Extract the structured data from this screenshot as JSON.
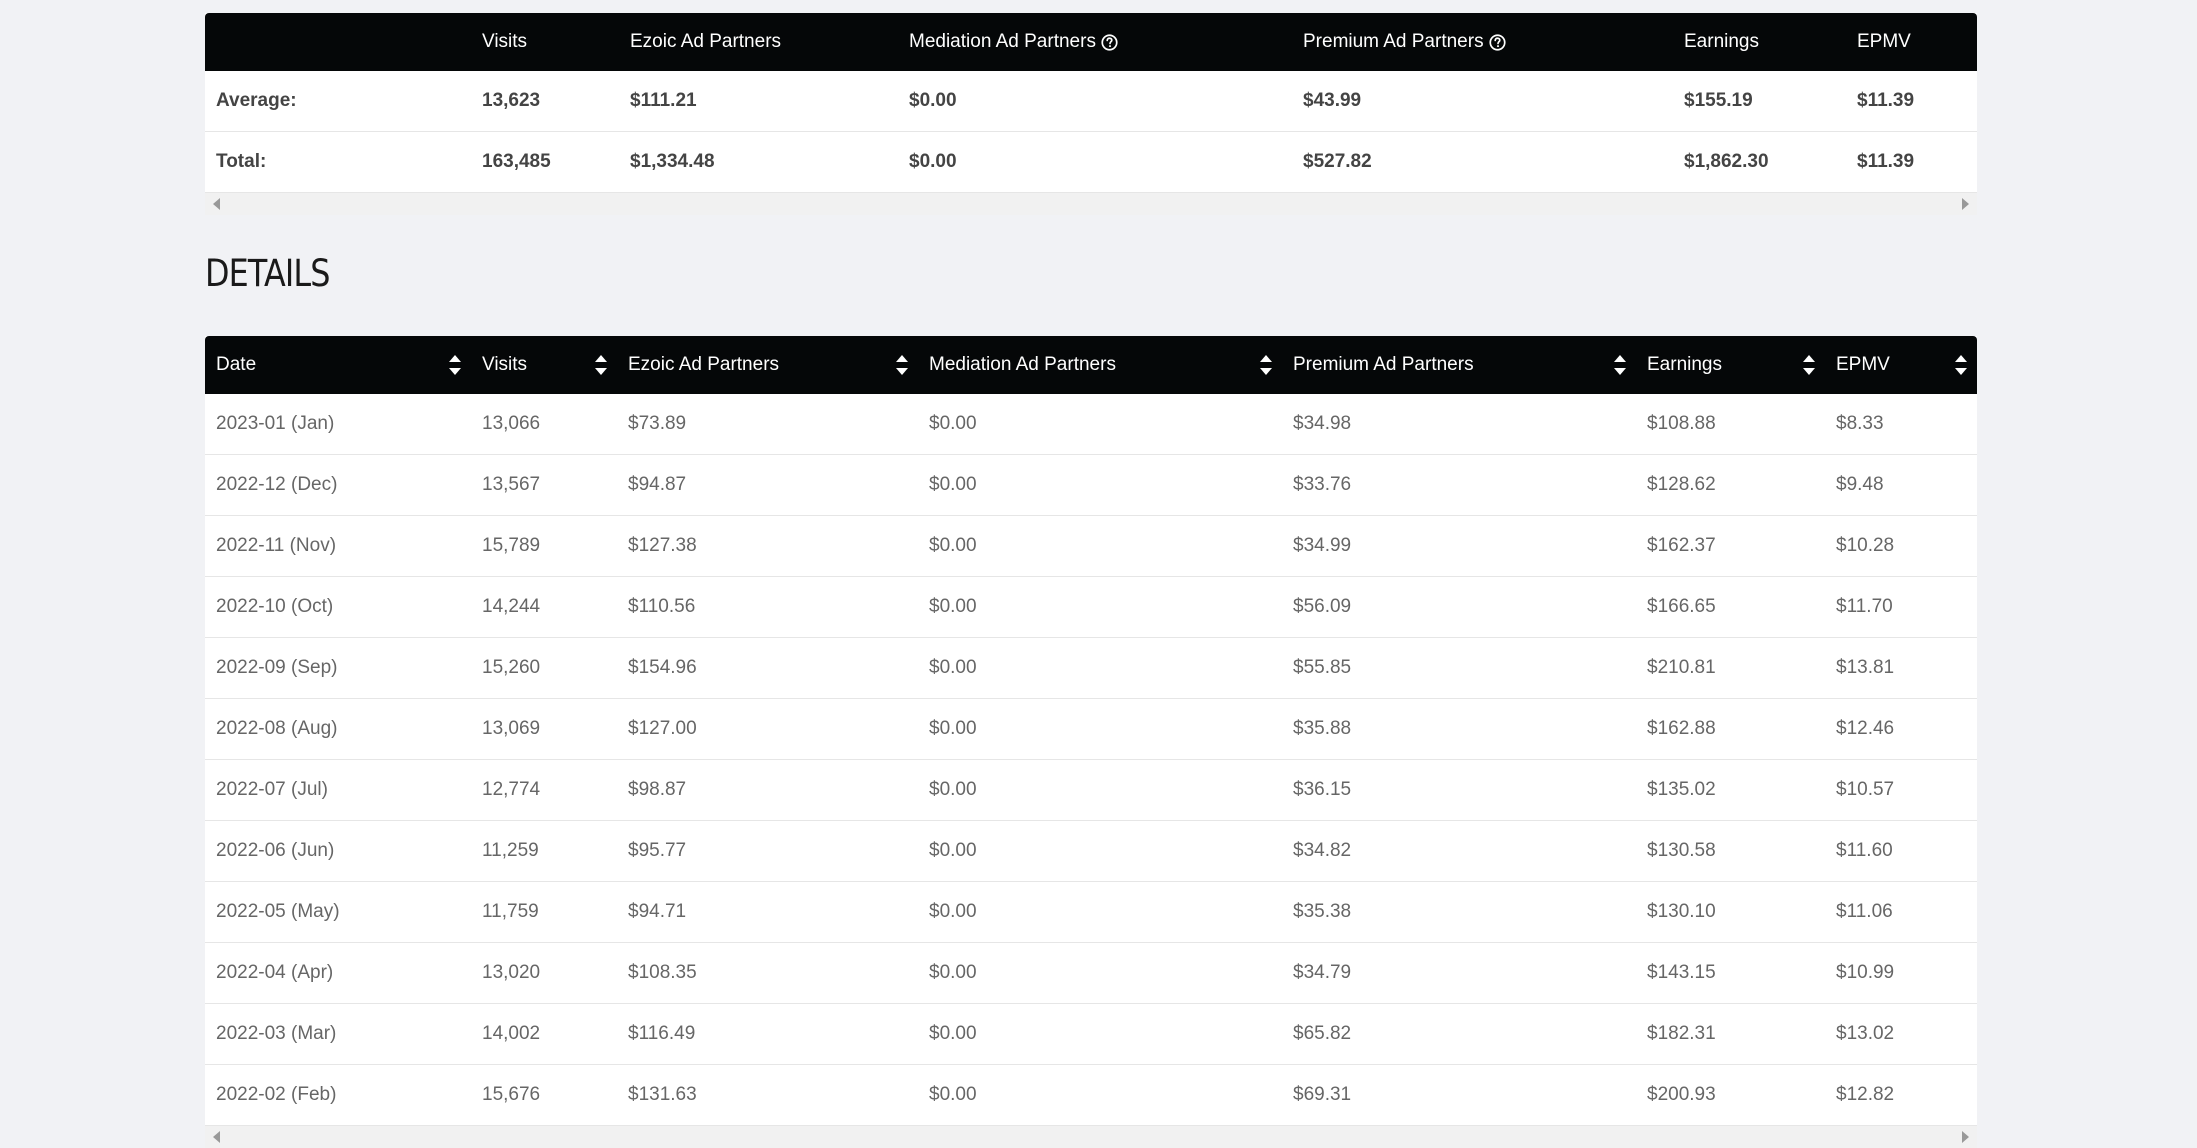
{
  "summary": {
    "headers": [
      "",
      "Visits",
      "Ezoic Ad Partners",
      "Mediation Ad Partners",
      "Premium Ad Partners",
      "Earnings",
      "EPMV"
    ],
    "rows": [
      [
        "Average:",
        "13,623",
        "$111.21",
        "$0.00",
        "$43.99",
        "$155.19",
        "$11.39"
      ],
      [
        "Total:",
        "163,485",
        "$1,334.48",
        "$0.00",
        "$527.82",
        "$1,862.30",
        "$11.39"
      ]
    ]
  },
  "details": {
    "title": "DETAILS",
    "headers": [
      "Date",
      "Visits",
      "Ezoic Ad Partners",
      "Mediation Ad Partners",
      "Premium Ad Partners",
      "Earnings",
      "EPMV"
    ],
    "rows": [
      [
        "2023-01 (Jan)",
        "13,066",
        "$73.89",
        "$0.00",
        "$34.98",
        "$108.88",
        "$8.33"
      ],
      [
        "2022-12 (Dec)",
        "13,567",
        "$94.87",
        "$0.00",
        "$33.76",
        "$128.62",
        "$9.48"
      ],
      [
        "2022-11 (Nov)",
        "15,789",
        "$127.38",
        "$0.00",
        "$34.99",
        "$162.37",
        "$10.28"
      ],
      [
        "2022-10 (Oct)",
        "14,244",
        "$110.56",
        "$0.00",
        "$56.09",
        "$166.65",
        "$11.70"
      ],
      [
        "2022-09 (Sep)",
        "15,260",
        "$154.96",
        "$0.00",
        "$55.85",
        "$210.81",
        "$13.81"
      ],
      [
        "2022-08 (Aug)",
        "13,069",
        "$127.00",
        "$0.00",
        "$35.88",
        "$162.88",
        "$12.46"
      ],
      [
        "2022-07 (Jul)",
        "12,774",
        "$98.87",
        "$0.00",
        "$36.15",
        "$135.02",
        "$10.57"
      ],
      [
        "2022-06 (Jun)",
        "11,259",
        "$95.77",
        "$0.00",
        "$34.82",
        "$130.58",
        "$11.60"
      ],
      [
        "2022-05 (May)",
        "11,759",
        "$94.71",
        "$0.00",
        "$35.38",
        "$130.10",
        "$11.06"
      ],
      [
        "2022-04 (Apr)",
        "13,020",
        "$108.35",
        "$0.00",
        "$34.79",
        "$143.15",
        "$10.99"
      ],
      [
        "2022-03 (Mar)",
        "14,002",
        "$116.49",
        "$0.00",
        "$65.82",
        "$182.31",
        "$13.02"
      ],
      [
        "2022-02 (Feb)",
        "15,676",
        "$131.63",
        "$0.00",
        "$69.31",
        "$200.93",
        "$12.82"
      ]
    ]
  }
}
